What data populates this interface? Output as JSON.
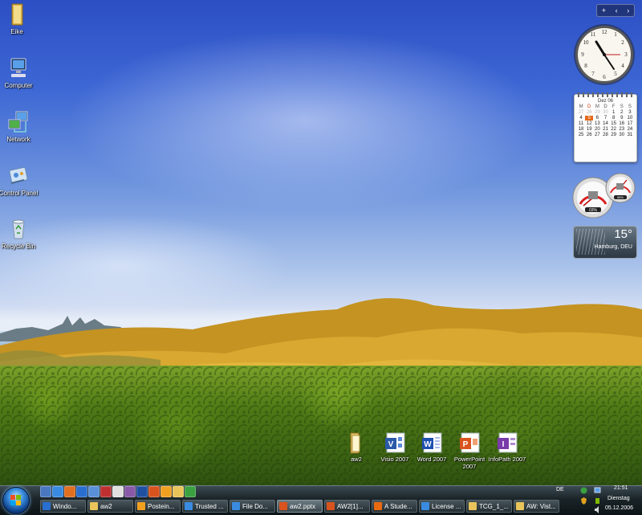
{
  "desktop": {
    "icons": [
      {
        "label": "Eike",
        "icon": "user-folder-icon"
      },
      {
        "label": "Computer",
        "icon": "computer-icon"
      },
      {
        "label": "Network",
        "icon": "network-icon"
      },
      {
        "label": "Control Panel",
        "icon": "control-panel-icon"
      },
      {
        "label": "Recycle Bin",
        "icon": "recycle-bin-icon"
      }
    ],
    "documents": [
      {
        "label": "aw2",
        "icon": "folder-icon"
      },
      {
        "label": "Visio 2007",
        "icon": "visio-icon"
      },
      {
        "label": "Word 2007",
        "icon": "word-icon"
      },
      {
        "label": "PowerPoint 2007",
        "icon": "powerpoint-icon"
      },
      {
        "label": "InfoPath 2007",
        "icon": "infopath-icon"
      }
    ]
  },
  "sidebar": {
    "controls": {
      "add": "+",
      "prev": "‹",
      "next": "›"
    },
    "calendar": {
      "month": "Dez 06",
      "weekdays": [
        "M",
        "D",
        "M",
        "D",
        "F",
        "S",
        "S"
      ],
      "rows": [
        [
          "27",
          "28",
          "29",
          "30",
          "1",
          "2",
          "3"
        ],
        [
          "4",
          "5",
          "6",
          "7",
          "8",
          "9",
          "10"
        ],
        [
          "11",
          "12",
          "13",
          "14",
          "15",
          "16",
          "17"
        ],
        [
          "18",
          "19",
          "20",
          "21",
          "22",
          "23",
          "24"
        ],
        [
          "25",
          "26",
          "27",
          "28",
          "29",
          "30",
          "31"
        ]
      ],
      "today": "5"
    },
    "meters": {
      "cpu_percent": "03%",
      "ram_percent": "56%"
    },
    "weather": {
      "temperature": "15°",
      "location": "Hamburg, DEU"
    }
  },
  "taskbar": {
    "tasks": [
      {
        "label": "Windo...",
        "color": "#2a6fd0"
      },
      {
        "label": "aw2",
        "color": "#e8c45a"
      },
      {
        "label": "Postein...",
        "color": "#f0a020"
      },
      {
        "label": "Trusted ...",
        "color": "#3a8be0"
      },
      {
        "label": "File Do...",
        "color": "#3a8be0"
      },
      {
        "label": "aw2.pptx",
        "color": "#d9531e"
      },
      {
        "label": "AW2[1]...",
        "color": "#d9531e"
      },
      {
        "label": "A Stude...",
        "color": "#e86a10"
      },
      {
        "label": "License ...",
        "color": "#3a8be0"
      },
      {
        "label": "TCG_1_...",
        "color": "#e8c45a"
      },
      {
        "label": "AW: Vist...",
        "color": "#e8c45a"
      }
    ],
    "active_task_index": 5,
    "tray": {
      "language": "DE",
      "time": "21:51",
      "day": "Dienstag",
      "date": "05.12.2006"
    }
  }
}
